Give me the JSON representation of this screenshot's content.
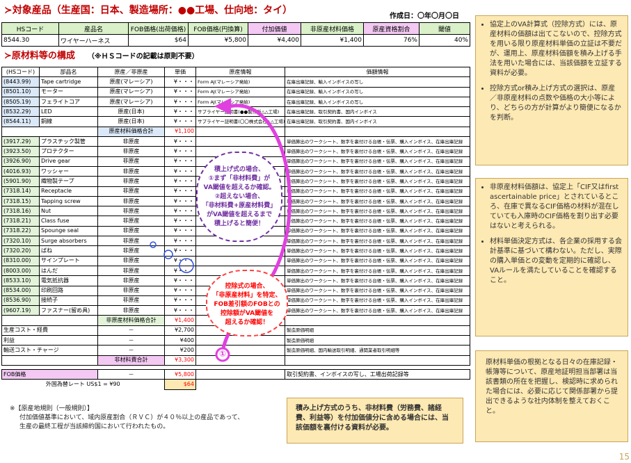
{
  "title": "≻対象産品（生産国：日本、製造場所：●●工場、仕向地：タイ）",
  "created": "作成日：〇年〇月〇日",
  "top_table": {
    "headers": [
      "HSコード",
      "産品名",
      "FOB価格(出荷価格)",
      "FOB価格(円換算)",
      "付加価値",
      "非原産材料価格",
      "原産資格割合",
      "閾値"
    ],
    "row": [
      "8544.30",
      "ワイヤーハーネス",
      "$64",
      "¥5,800",
      "¥4,400",
      "¥1,400",
      "76%",
      "40%"
    ]
  },
  "section2": {
    "title": "≻原材料等の構成",
    "note": "（※ＨＳコードの記載は原則不要）"
  },
  "main_headers": [
    "(HSコード)",
    "部品名",
    "原産／非原産",
    "単価",
    "原産情報",
    "価額情報"
  ],
  "orig_rows": [
    {
      "hs": "(8443.99)",
      "name": "Tape cartridge",
      "origin": "原産(マレーシア)",
      "price": "¥・・・",
      "info": "Form AJ(マレーシア発給)",
      "value": "在庫出庫記録、輸入インボイスの写し"
    },
    {
      "hs": "(8501.10)",
      "name": "モーター",
      "origin": "原産(マレーシア)",
      "price": "¥・・・",
      "info": "Form AJ(マレーシア発給)",
      "value": "在庫出庫記録、輸入インボイスの写し"
    },
    {
      "hs": "(8505.19)",
      "name": "フェライトコア",
      "origin": "原産(マレーシア)",
      "price": "¥・・・",
      "info": "Form AJ(マレーシア発給)",
      "value": "在庫出庫記録、輸入インボイスの写し"
    },
    {
      "hs": "(8532.29)",
      "name": "LED",
      "origin": "原産(日本)",
      "price": "¥・・・",
      "info": "サプライヤー証明書(●●製作所△△工場)",
      "value": "在庫出庫記録、取引契約書、国内インボイス"
    },
    {
      "hs": "(8544.11)",
      "name": "銅線",
      "origin": "原産(日本)",
      "price": "¥・・・",
      "info": "サプライヤー証明書(〇〇株式会社△△工場)",
      "value": "在庫出庫記録、取引契約書、国内インボイス"
    }
  ],
  "orig_total": {
    "label": "原産材料価格合計",
    "value": "¥1,100"
  },
  "non_rows": [
    {
      "hs": "(3917.29)",
      "name": "プラスチック製管",
      "origin": "非原産",
      "price": "¥・・・"
    },
    {
      "hs": "(3923.50)",
      "name": "プロテクター",
      "origin": "非原産",
      "price": "¥・・・"
    },
    {
      "hs": "(3926.90)",
      "name": "Drive gear",
      "origin": "非原産",
      "price": "¥・・・"
    },
    {
      "hs": "(4016.93)",
      "name": "ワッシャー",
      "origin": "非原産",
      "price": "¥・・・"
    },
    {
      "hs": "(5901.90)",
      "name": "織物製テープ",
      "origin": "非原産",
      "price": "¥・・・"
    },
    {
      "hs": "(7318.14)",
      "name": "Receptacle",
      "origin": "非原産",
      "price": "¥・・・"
    },
    {
      "hs": "(7318.15)",
      "name": "Tapping screw",
      "origin": "非原産",
      "price": "¥・・・"
    },
    {
      "hs": "(7318.16)",
      "name": "Nut",
      "origin": "非原産",
      "price": "¥・・・"
    },
    {
      "hs": "(7318.21)",
      "name": "Class fuse",
      "origin": "非原産",
      "price": "¥・・・"
    },
    {
      "hs": "(7318.22)",
      "name": "Spounge seal",
      "origin": "非原産",
      "price": "¥・・・"
    },
    {
      "hs": "(7320.10)",
      "name": "Surge absorbers",
      "origin": "非原産",
      "price": "¥・・・"
    },
    {
      "hs": "(7320.20)",
      "name": "ばね",
      "origin": "非原産",
      "price": "¥・・・"
    },
    {
      "hs": "(8310.00)",
      "name": "サインプレート",
      "origin": "非原産",
      "price": "¥・・・"
    },
    {
      "hs": "(8003.00)",
      "name": "はんだ",
      "origin": "非原産",
      "price": "¥・・・"
    },
    {
      "hs": "(8533.10)",
      "name": "電気抵抗器",
      "origin": "非原産",
      "price": "¥・・・"
    },
    {
      "hs": "(8534.00)",
      "name": "印刷回路",
      "origin": "非原産",
      "price": "¥・・・"
    },
    {
      "hs": "(8536.90)",
      "name": "接続子",
      "origin": "非原産",
      "price": "¥・・・"
    },
    {
      "hs": "(9607.19)",
      "name": "ファスナー(留め具)",
      "origin": "非原産",
      "price": "¥・・・"
    }
  ],
  "non_value_text": "単価算出のワークシート、数字を裏付ける台帳・伝票、購入インボイス、在庫出庫記録",
  "non_total": {
    "label": "非原産材料価格合計",
    "value": "¥1,400"
  },
  "cost_rows": [
    {
      "name": "生産コスト・経費",
      "origin": "－",
      "price": "¥2,700",
      "value": "製造原価明細"
    },
    {
      "name": "利益",
      "origin": "－",
      "price": "¥400",
      "value": "製造原価明細"
    },
    {
      "name": "輸送コスト・チャージ",
      "origin": "－",
      "price": "¥200",
      "value": "製造原価明細、国内輸送取引明細、通関業者取引明細等"
    }
  ],
  "cost_total": {
    "label": "非材料費合計",
    "value": "¥3,300"
  },
  "fob_row": {
    "name": "FOB価格",
    "origin": "－",
    "price": "¥5,800",
    "value": "取引契約書、インボイスの写し、工場出荷記録等"
  },
  "rate_row": {
    "label": "外国為替レート US$1 = ¥90",
    "value": "$64"
  },
  "cloud1": [
    "積上げ式の場合、",
    "①まず「非材料費」が",
    "VA閾値を超えるか確認。",
    "②超えない場合、",
    "「非材料費+原産材料費」",
    "がVA閾値を超えるまで",
    "積上げると簡便！"
  ],
  "cloud2": [
    "控除式の場合、",
    "「非原産材料」を特定、",
    "FOB差引額のFOBとの",
    "控除額がVA閾値を",
    "超えるか確認！"
  ],
  "circle_label": "①",
  "side_box_1": [
    "協定上のVA計算式（控除方式）には、原産材料の価額は出てこないので、控除方式を用いる限り原産材料単価の立証は不要だが、運用上、原産材料価額を積み上げる手法を用いた場合には、当該価額を立証する資料が必要。",
    "控除方式or積み上げ方式の選択は、原産／非原産材料の点数や価格の大小等により、どちらの方が計算がより簡便になるかを判断。"
  ],
  "side_box_2": [
    "非原産材料価額は、協定上「CIF又はfirst ascertainable price」とされているところ、在庫で異なるCIF価格の材料が混在していても入庫時のCIF価格を割り出す必要はないと考えられる。",
    "材料単価決定方式は、各企業の採用する会計基準に基づいて構わない。ただし、実際の購入単価との変動を定期的に確認し、VAルールを満たしていることを確認すること。"
  ],
  "side_box_3": "原材料単価の根拠となる日々の在庫記録・帳簿等について、原産地証明担当部署は当該書類の所在を把握し、検認時に求められた場合には、必要に応じて関係部署から提出できるような社内体制を整えておくこと。",
  "bottom_box": "積み上げ方式のうち、非材料費（労務費、諸経費、利益等）を付加価値分に含める場合には、当該価額を裏付ける資料が必要。",
  "footnote": [
    "※【原産地規則（一般規則）】",
    "付加価値基準において、域内原産割合（ＲＶＣ）が４０％以上の産品であって、",
    "生産の最終工程が当該締約国において行われたもの。"
  ],
  "page_number": "15"
}
